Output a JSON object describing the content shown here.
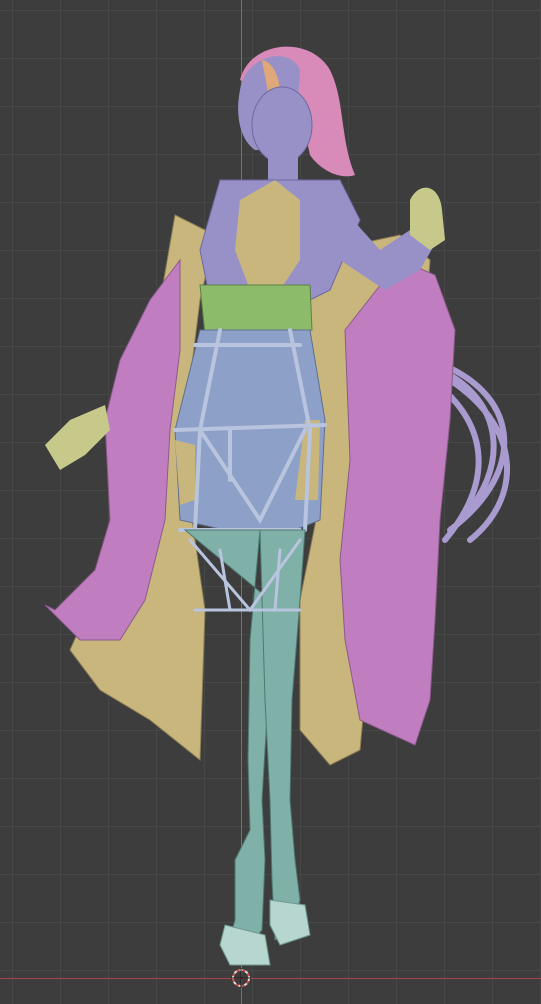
{
  "viewport": {
    "view": "front-orthographic",
    "background_color": "#3d3d3d",
    "grid": true,
    "grid_color": "#474747",
    "axis_colors": {
      "x": "#a8414a",
      "z": "#4a7ab3"
    }
  },
  "model": {
    "icon": "character-mesh",
    "material_colors": {
      "skin": "#9891c8",
      "robe_outer": "#c9b67d",
      "robe_inner": "#c07ec0",
      "bodysuit": "#8da0c8",
      "legs": "#7fb1a8",
      "sash": "#8cbc6a",
      "hair_pink": "#d88ab8",
      "hair_orange": "#e0a878",
      "accent_green": "#8cbc6a",
      "skin_hand": "#c6c98a"
    }
  },
  "origin": {
    "icon": "3d-cursor-icon"
  }
}
